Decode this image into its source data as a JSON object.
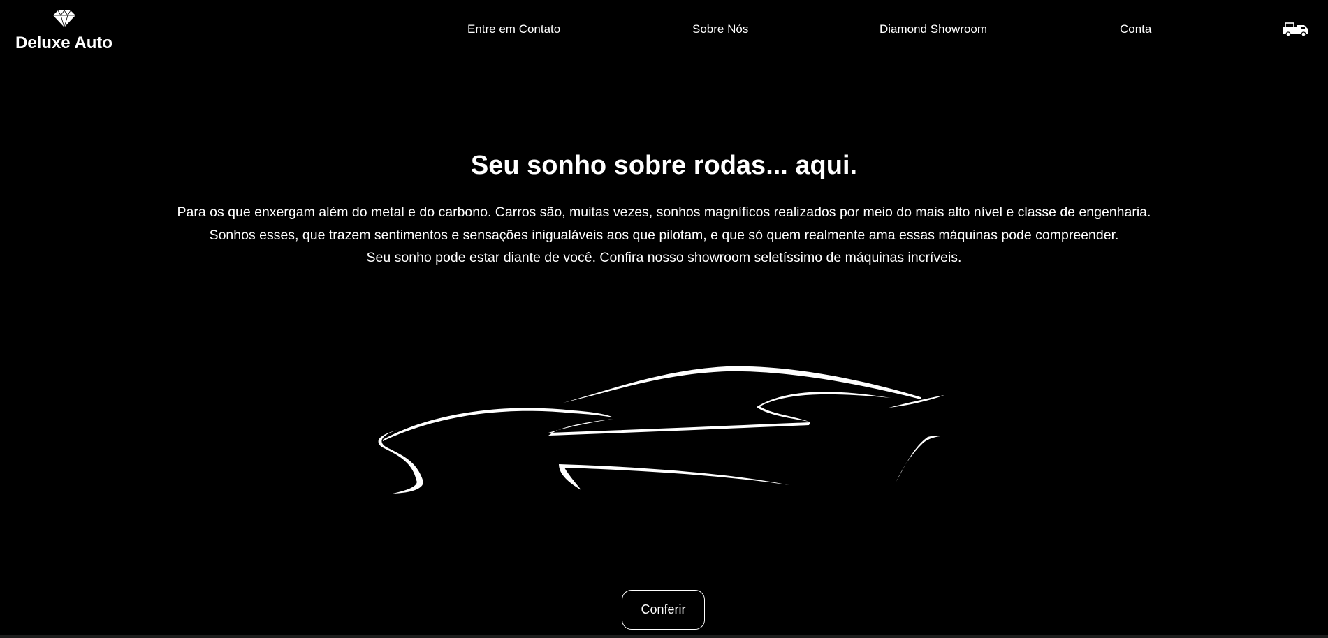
{
  "brand": {
    "name": "Deluxe Auto",
    "logo_icon": "diamond-icon"
  },
  "nav": {
    "items": [
      {
        "label": "Entre em Contato"
      },
      {
        "label": "Sobre Nós"
      },
      {
        "label": "Diamond Showroom"
      },
      {
        "label": "Conta"
      }
    ],
    "cart_icon": "delivery-truck-icon"
  },
  "hero": {
    "title": "Seu sonho sobre rodas... aqui.",
    "lines": [
      "Para os que enxergam além do metal e do carbono. Carros são, muitas vezes, sonhos magníficos realizados por meio do mais alto nível e classe de engenharia.",
      "Sonhos esses, que trazem sentimentos e sensações inigualáveis aos que pilotam, e que só quem realmente ama essas máquinas pode compreender.",
      "Seu sonho pode estar diante de você. Confira nosso showroom seletíssimo de máquinas incríveis."
    ],
    "illustration": "sports-car-silhouette",
    "cta_label": "Conferir"
  },
  "colors": {
    "background": "#000000",
    "text": "#ffffff"
  }
}
